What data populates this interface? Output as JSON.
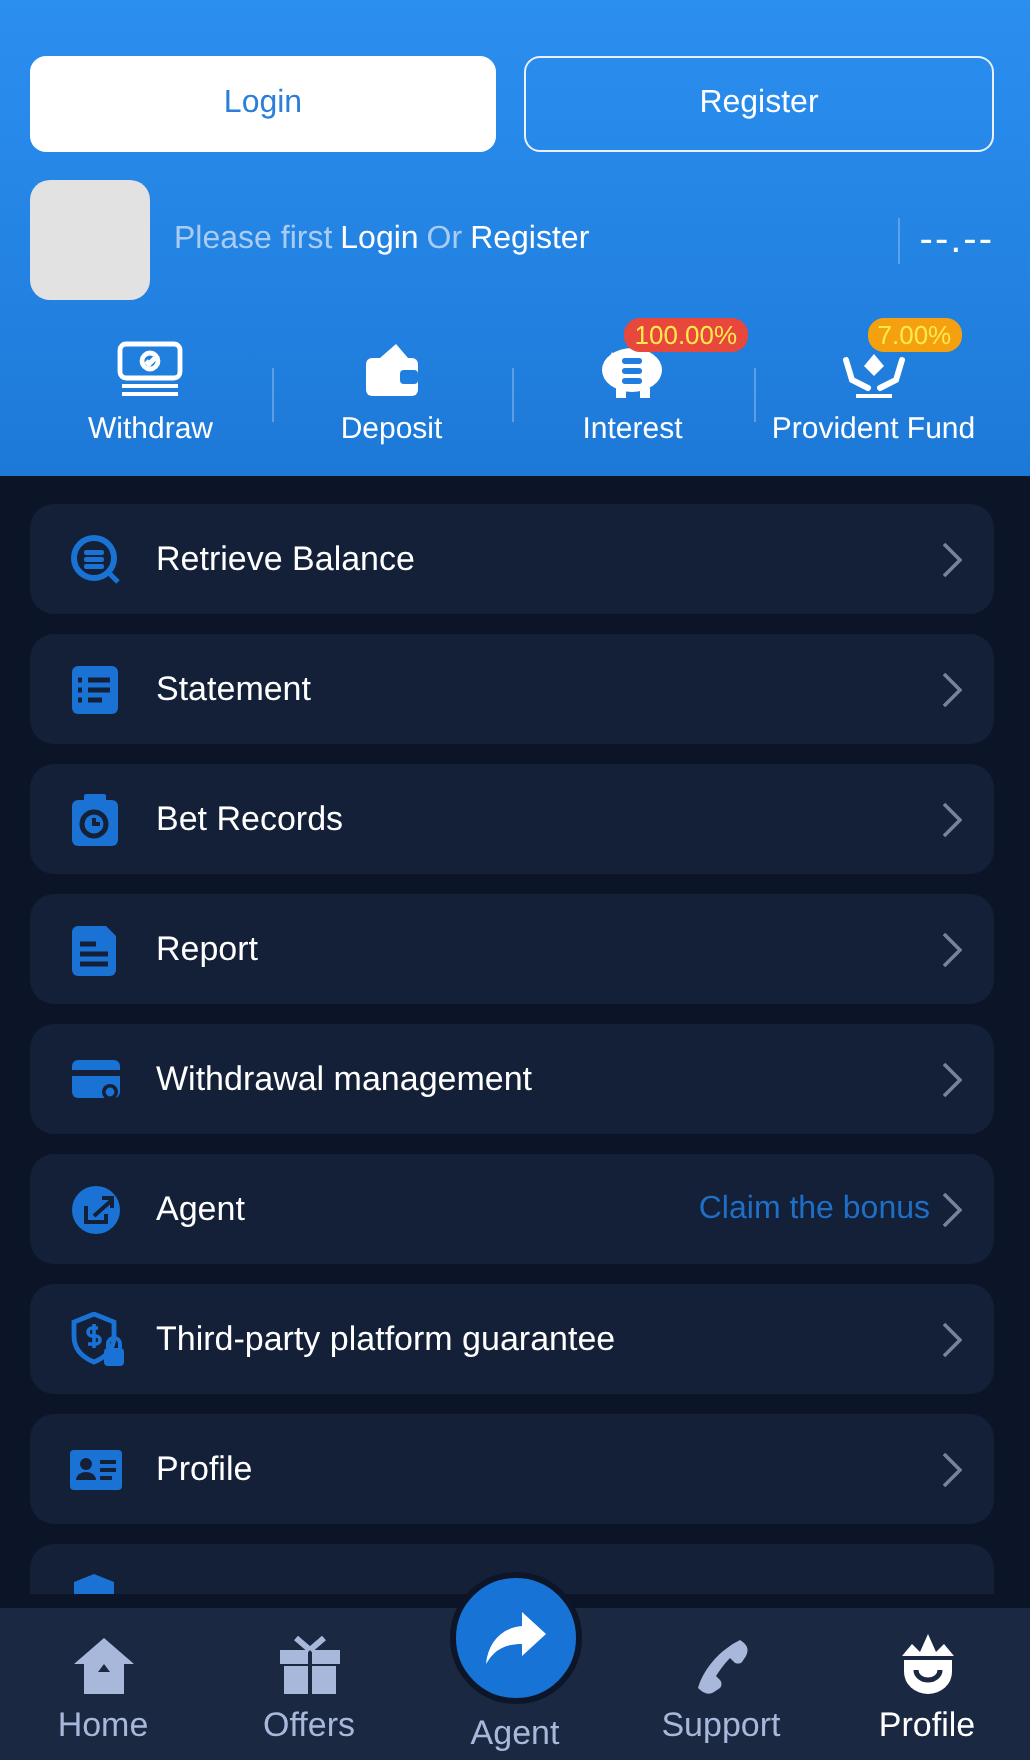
{
  "auth_buttons": [
    {
      "label": "Login",
      "selected": true
    },
    {
      "label": "Register",
      "selected": false
    }
  ],
  "user": {
    "prompt": "Please first",
    "login_link": "Login",
    "separator": "Or",
    "register_link": "Register",
    "balance": "--.--"
  },
  "quick_actions": [
    {
      "label": "Withdraw"
    },
    {
      "label": "Deposit"
    },
    {
      "label": "Interest",
      "badge": "100.00%",
      "color": "#e8483c"
    },
    {
      "label": "Provident Fund",
      "badge": "7.00%",
      "color": "#f5a10f"
    }
  ],
  "menu": [
    {
      "kind": "row",
      "label": "Retrieve Balance"
    },
    {
      "kind": "row",
      "label": "Statement"
    },
    {
      "kind": "row",
      "label": "Bet Records"
    },
    {
      "kind": "row",
      "label": "Report"
    },
    {
      "kind": "row",
      "label": "Withdrawal management"
    },
    {
      "kind": "row",
      "label": "Agent",
      "note": "Claim the bonus"
    },
    {
      "kind": "row",
      "label": "Third-party platform guarantee"
    },
    {
      "kind": "row",
      "label": "Profile"
    },
    {
      "kind": "cut"
    }
  ],
  "bottom_nav": [
    {
      "label": "Home",
      "kind": "tab",
      "selected": false
    },
    {
      "label": "Offers",
      "kind": "tab",
      "selected": false
    },
    {
      "label": "Agent",
      "kind": "raised",
      "selected": false
    },
    {
      "label": "Support",
      "kind": "tab",
      "selected": false
    },
    {
      "label": "Profile",
      "kind": "tab",
      "selected": true
    }
  ]
}
